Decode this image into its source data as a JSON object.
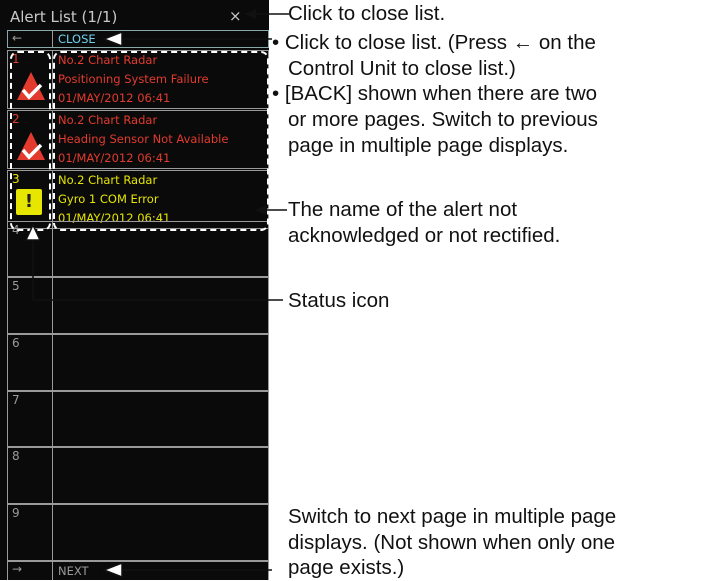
{
  "panel": {
    "title": "Alert List (1/1)",
    "close_x": "×",
    "back_arrow": "←",
    "close_label": "CLOSE",
    "next_arrow": "→",
    "next_label": "NEXT",
    "alerts": [
      {
        "number": "1",
        "line1": "No.2 Chart Radar",
        "line2": "Positioning System Failure",
        "line3": "01/MAY/2012 06:41",
        "icon": "warning-acknowledged-icon"
      },
      {
        "number": "2",
        "line1": "No.2 Chart Radar",
        "line2": "Heading Sensor Not Available",
        "line3": "01/MAY/2012 06:41",
        "icon": "warning-acknowledged-icon"
      },
      {
        "number": "3",
        "line1": "No.2 Chart Radar",
        "line2": "Gyro 1 COM Error",
        "line3": "01/MAY/2012 06:41",
        "icon": "caution-icon"
      }
    ],
    "empty_rows": [
      "4",
      "5",
      "6",
      "7",
      "8",
      "9"
    ],
    "colors": {
      "alarm": "#e23b2e",
      "caution": "#e6e600",
      "frame": "#9a9a9a",
      "close_text": "#6fd3ef"
    }
  },
  "callouts": {
    "close_x": "Click to close list.",
    "close_bullet_line1": "• Click to close list. (Press ← on the",
    "close_bullet_line2": "Control Unit to close list.)",
    "back_bullet_line1": "• [BACK] shown when there are two",
    "back_bullet_line2": "or more pages. Switch to previous",
    "back_bullet_line3": "page in multiple page displays.",
    "alert_name_line1": "The name of the alert not",
    "alert_name_line2": "acknowledged or not rectified.",
    "status_icon": "Status icon",
    "next_line1": "Switch to next page in multiple page",
    "next_line2": "displays. (Not shown when only one",
    "next_line3": "page exists.)"
  }
}
